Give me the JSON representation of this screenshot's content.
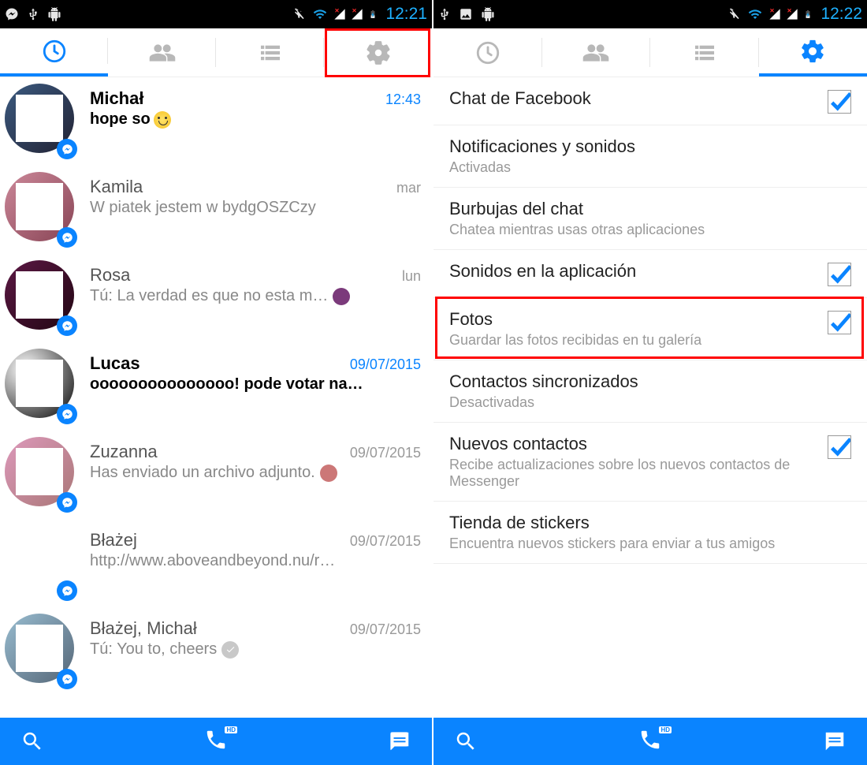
{
  "left_screen": {
    "status_time": "12:21",
    "active_tab": 0,
    "highlighted_tab": 3,
    "chats": [
      {
        "name": "Michał",
        "time": "12:43",
        "time_active": true,
        "preview": "hope so",
        "emoji": true,
        "bold": true,
        "avatar_bg": "linear-gradient(135deg,#3b5a80,#223)"
      },
      {
        "name": "Kamila",
        "time": "mar",
        "time_active": false,
        "preview": "W piatek jestem w bydgOSZCzy",
        "bold": false,
        "avatar_bg": "linear-gradient(135deg,#c89,#845)"
      },
      {
        "name": "Rosa",
        "time": "lun",
        "time_active": false,
        "preview": "Tú: La verdad es que no esta m…",
        "bold": false,
        "mini_avatar": true,
        "avatar_bg": "linear-gradient(135deg,#5b1844,#220612)"
      },
      {
        "name": "Lucas",
        "time": "09/07/2015",
        "time_active": true,
        "preview": "ooooooooooooooo! pode votar na…",
        "bold": true,
        "avatar_bg": "radial-gradient(circle at 30% 30%,#fff,#000)"
      },
      {
        "name": "Zuzanna",
        "time": "09/07/2015",
        "time_active": false,
        "preview": "Has enviado un archivo adjunto.",
        "bold": false,
        "mini_avatar": true,
        "mini_bg": "#c77",
        "avatar_bg": "linear-gradient(135deg,#d9b,#a77)"
      },
      {
        "name": "Błażej",
        "time": "09/07/2015",
        "time_active": false,
        "preview": "http://www.aboveandbeyond.nu/r…",
        "bold": false,
        "avatar_bg": "#fff"
      },
      {
        "name": "Błażej, Michał",
        "time": "09/07/2015",
        "time_active": false,
        "preview": "Tú: You to, cheers",
        "bold": false,
        "check": true,
        "avatar_bg": "linear-gradient(135deg,#98bcd0,#567)"
      }
    ]
  },
  "right_screen": {
    "status_time": "12:22",
    "active_tab": 3,
    "highlighted_row": 4,
    "settings": [
      {
        "title": "Chat de Facebook",
        "sub": "",
        "checkbox": true
      },
      {
        "title": "Notificaciones y sonidos",
        "sub": "Activadas",
        "checkbox": false
      },
      {
        "title": "Burbujas del chat",
        "sub": "Chatea mientras usas otras aplicaciones",
        "checkbox": false
      },
      {
        "title": "Sonidos en la aplicación",
        "sub": "",
        "checkbox": true
      },
      {
        "title": "Fotos",
        "sub": "Guardar las fotos recibidas en tu galería",
        "checkbox": true
      },
      {
        "title": "Contactos sincronizados",
        "sub": "Desactivadas",
        "checkbox": false
      },
      {
        "title": "Nuevos contactos",
        "sub": "Recibe actualizaciones sobre los nuevos contactos de Messenger",
        "checkbox": true
      },
      {
        "title": "Tienda de stickers",
        "sub": "Encuentra nuevos stickers para enviar a tus amigos",
        "checkbox": false
      }
    ]
  }
}
